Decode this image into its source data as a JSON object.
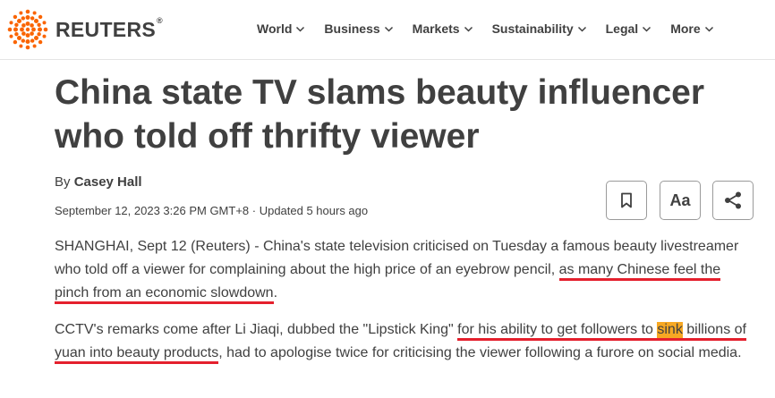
{
  "brand": {
    "name": "REUTERS",
    "registered": "®"
  },
  "nav": {
    "items": [
      {
        "label": "World"
      },
      {
        "label": "Business"
      },
      {
        "label": "Markets"
      },
      {
        "label": "Sustainability"
      },
      {
        "label": "Legal"
      },
      {
        "label": "More"
      }
    ]
  },
  "article": {
    "headline_line1": "China state TV slams beauty influencer",
    "headline_line2": "who told off thrifty viewer",
    "by_prefix": "By",
    "author": "Casey Hall",
    "dateline": "September 12, 2023 3:26 PM GMT+8 · Updated 5 hours ago",
    "p1": {
      "text_a": "SHANGHAI, Sept 12 (Reuters) - China's state television criticised on Tuesday a famous beauty livestreamer who told off a viewer for complaining about the high price of an eyebrow pencil, ",
      "text_b": "as many Chinese feel the pinch from an economic slowdown",
      "text_c": "."
    },
    "p2": {
      "text_a": "CCTV's remarks come after Li Jiaqi, dubbed the \"Lipstick King\" ",
      "text_b": "for his ability to get followers to ",
      "text_hl": "sink",
      "text_c": " billions of yuan into beauty products",
      "text_d": ", had to apologise twice for criticising the viewer following a furore on social media."
    }
  },
  "tools": {
    "font_label": "Aa",
    "icons": [
      "bookmark-icon",
      "font-size-icon",
      "share-icon"
    ]
  },
  "colors": {
    "underline": "#e4202d",
    "highlight": "#f7a823",
    "logo": "#fa6400",
    "text": "#404040"
  }
}
